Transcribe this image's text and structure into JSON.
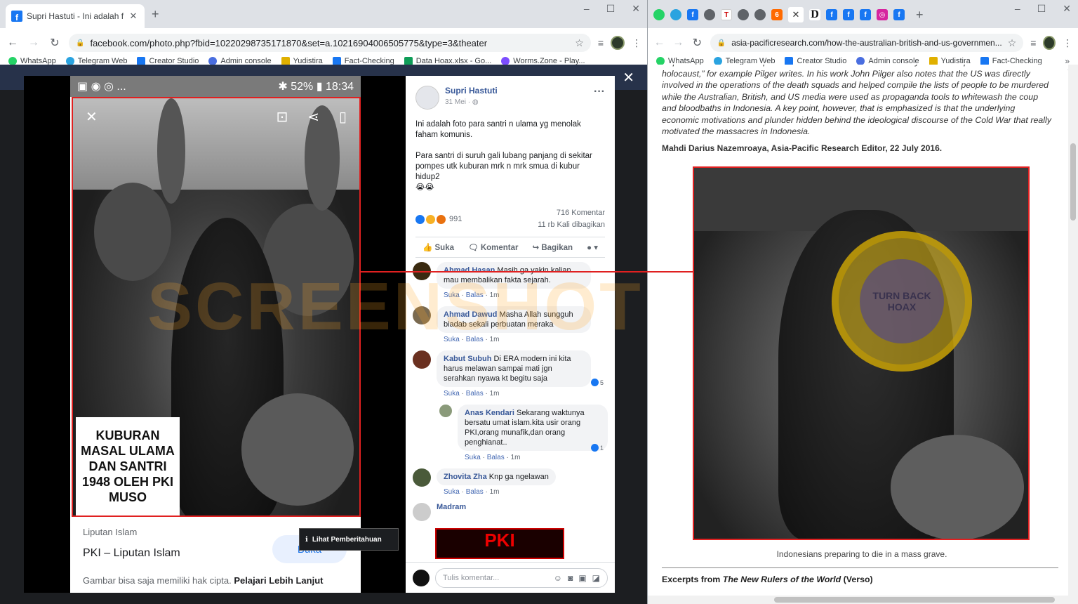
{
  "left_window": {
    "tab_title": "Supri Hastuti - Ini adalah foto pa",
    "url": "facebook.com/photo.php?fbid=10220298735171870&set=a.10216904006505775&type=3&theater",
    "bookmarks": [
      "WhatsApp",
      "Telegram Web",
      "Creator Studio",
      "Admin console",
      "Yudistira",
      "Fact-Checking",
      "Data Hoax.xlsx - Go...",
      "Worms.Zone - Play..."
    ]
  },
  "phone": {
    "status_left": "▣ ◉ ◎ ...",
    "status_right": "✱ 52% ▮ 18:34",
    "caption": "KUBURAN MASAL ULAMA DAN SANTRI 1948 OLEH PKI MUSO",
    "source": "Liputan Islam",
    "title": "PKI – Liputan Islam",
    "open_label": "Buka",
    "copyright_note": "Gambar bisa saja memiliki hak cipta.",
    "learn_more": "Pelajari Lebih Lanjut"
  },
  "notification_label": "Lihat Pemberitahuan",
  "watermark": "SCREENSHOT BY",
  "post": {
    "author": "Supri Hastuti",
    "date": "31 Mei",
    "text": "Ini adalah foto para santri n ulama yg menolak faham komunis.\n\nPara santri di suruh gali lubang panjang di sekitar pompes utk kuburan mrk n mrk smua di kubur hidup2\n😭😭",
    "reaction_count": "991",
    "comment_count": "716 Komentar",
    "share_count": "11 rb Kali dibagikan",
    "actions": {
      "like": "Suka",
      "comment": "Komentar",
      "share": "Bagikan"
    },
    "comment_placeholder": "Tulis komentar..."
  },
  "comments": [
    {
      "name": "Ahmad Hasan",
      "text": "Masih ga yakin kalian ... mau membalikan fakta sejarah.",
      "meta_like": "Suka",
      "meta_reply": "Balas",
      "time": "1m",
      "likes": "",
      "avatar": "#3a2a10"
    },
    {
      "name": "Ahmad Dawud",
      "text": "Masha Allah sungguh biadab sekali perbuatan meraka",
      "meta_like": "Suka",
      "meta_reply": "Balas",
      "time": "1m",
      "likes": "",
      "avatar": "#7a6a50"
    },
    {
      "name": "Kabut Subuh",
      "text": "Di ERA modern ini kita harus melawan sampai mati jgn serahkan nyawa kt begitu saja",
      "meta_like": "Suka",
      "meta_reply": "Balas",
      "time": "1m",
      "likes": "5",
      "avatar": "#6a3020"
    },
    {
      "name": "Anas Kendari",
      "text": "Sekarang waktunya bersatu umat islam.kita usir orang PKI,orang munafik,dan orang penghianat..",
      "meta_like": "Suka",
      "meta_reply": "Balas",
      "time": "1m",
      "likes": "1",
      "avatar": "#8a9a7a",
      "reply": true
    },
    {
      "name": "Zhovita Zha",
      "text": "Knp ga ngelawan",
      "meta_like": "Suka",
      "meta_reply": "Balas",
      "time": "1m",
      "likes": "",
      "avatar": "#4a5a3a"
    },
    {
      "name": "Madram",
      "text": "",
      "meta_like": "",
      "meta_reply": "",
      "time": "",
      "likes": "",
      "avatar": "#cccccc"
    }
  ],
  "madram_image_text": "PKI",
  "right_window": {
    "url": "asia-pacificresearch.com/how-the-australian-british-and-us-governmen...",
    "bookmarks": [
      "WhatsApp",
      "Telegram Web",
      "Creator Studio",
      "Admin console",
      "Yudistira",
      "Fact-Checking"
    ],
    "article_text": "ship full of Indonesian troops down the Malacca Straits so that they could take part in this terrible holocaust,” for example Pilger writes. In his work John Pilger also notes that the US was directly involved in the operations of the death squads and helped compile the lists of people to be murdered while the Australian, British, and US media were used as propaganda tools to whitewash the coup and bloodbaths in Indonesia. A key point, however, that is emphasized is that the underlying economic motivations and plunder hidden behind the ideological discourse of the Cold War that really motivated the massacres in Indonesia.",
    "byline": "Mahdi Darius Nazemroaya, Asia-Pacific Research Editor, 22 July 2016.",
    "seal_text": "TURN BACK HOAX",
    "photo_caption": "Indonesians preparing to die in a mass grave.",
    "excerpt_prefix": "Excerpts from",
    "excerpt_title": "The New Rulers of the World",
    "excerpt_suffix": "(Verso)"
  },
  "colors": {
    "fb_blue": "#385898",
    "highlight_red": "#e02020",
    "watermark_orange": "#ffaa28"
  }
}
